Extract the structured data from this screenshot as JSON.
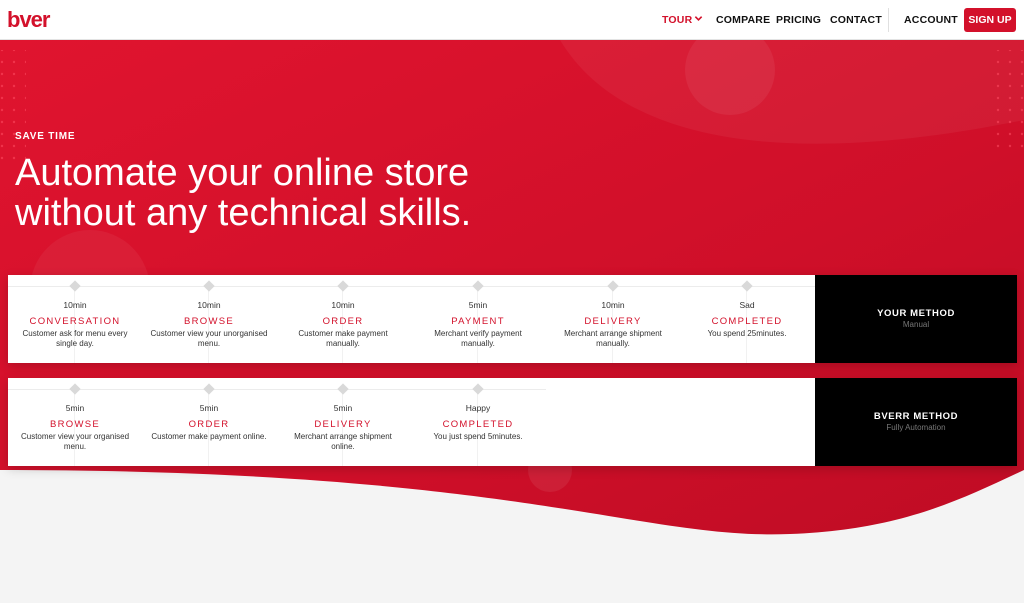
{
  "nav": {
    "logo_text": "bver",
    "items": [
      {
        "label": "TOUR",
        "active": true,
        "has_dropdown": true
      },
      {
        "label": "COMPARE"
      },
      {
        "label": "PRICING"
      },
      {
        "label": "CONTACT"
      }
    ],
    "account_label": "ACCOUNT",
    "signup_label": "SIGN UP"
  },
  "hero": {
    "eyebrow": "SAVE TIME",
    "headline_line1": "Automate your online store",
    "headline_line2": "without any technical skills."
  },
  "your_method": {
    "title": "YOUR METHOD",
    "subtitle": "Manual",
    "steps": [
      {
        "time": "10min",
        "title": "CONVERSATION",
        "desc": "Customer ask for menu every single day."
      },
      {
        "time": "10min",
        "title": "BROWSE",
        "desc": "Customer view your unorganised menu."
      },
      {
        "time": "10min",
        "title": "ORDER",
        "desc": "Customer make payment manually."
      },
      {
        "time": "5min",
        "title": "PAYMENT",
        "desc": "Merchant verify payment manually."
      },
      {
        "time": "10min",
        "title": "DELIVERY",
        "desc": "Merchant arrange shipment manually."
      },
      {
        "time": "Sad",
        "title": "COMPLETED",
        "desc": "You spend 25minutes."
      }
    ]
  },
  "bverr_method": {
    "title": "BVERR METHOD",
    "subtitle": "Fully Automation",
    "steps": [
      {
        "time": "5min",
        "title": "BROWSE",
        "desc": "Customer view your organised menu."
      },
      {
        "time": "5min",
        "title": "ORDER",
        "desc": "Customer make payment online."
      },
      {
        "time": "5min",
        "title": "DELIVERY",
        "desc": "Merchant arrange shipment online."
      },
      {
        "time": "Happy",
        "title": "COMPLETED",
        "desc": "You just spend 5minutes."
      }
    ]
  },
  "colors": {
    "brand_red": "#d3112b",
    "dark": "#000000"
  }
}
